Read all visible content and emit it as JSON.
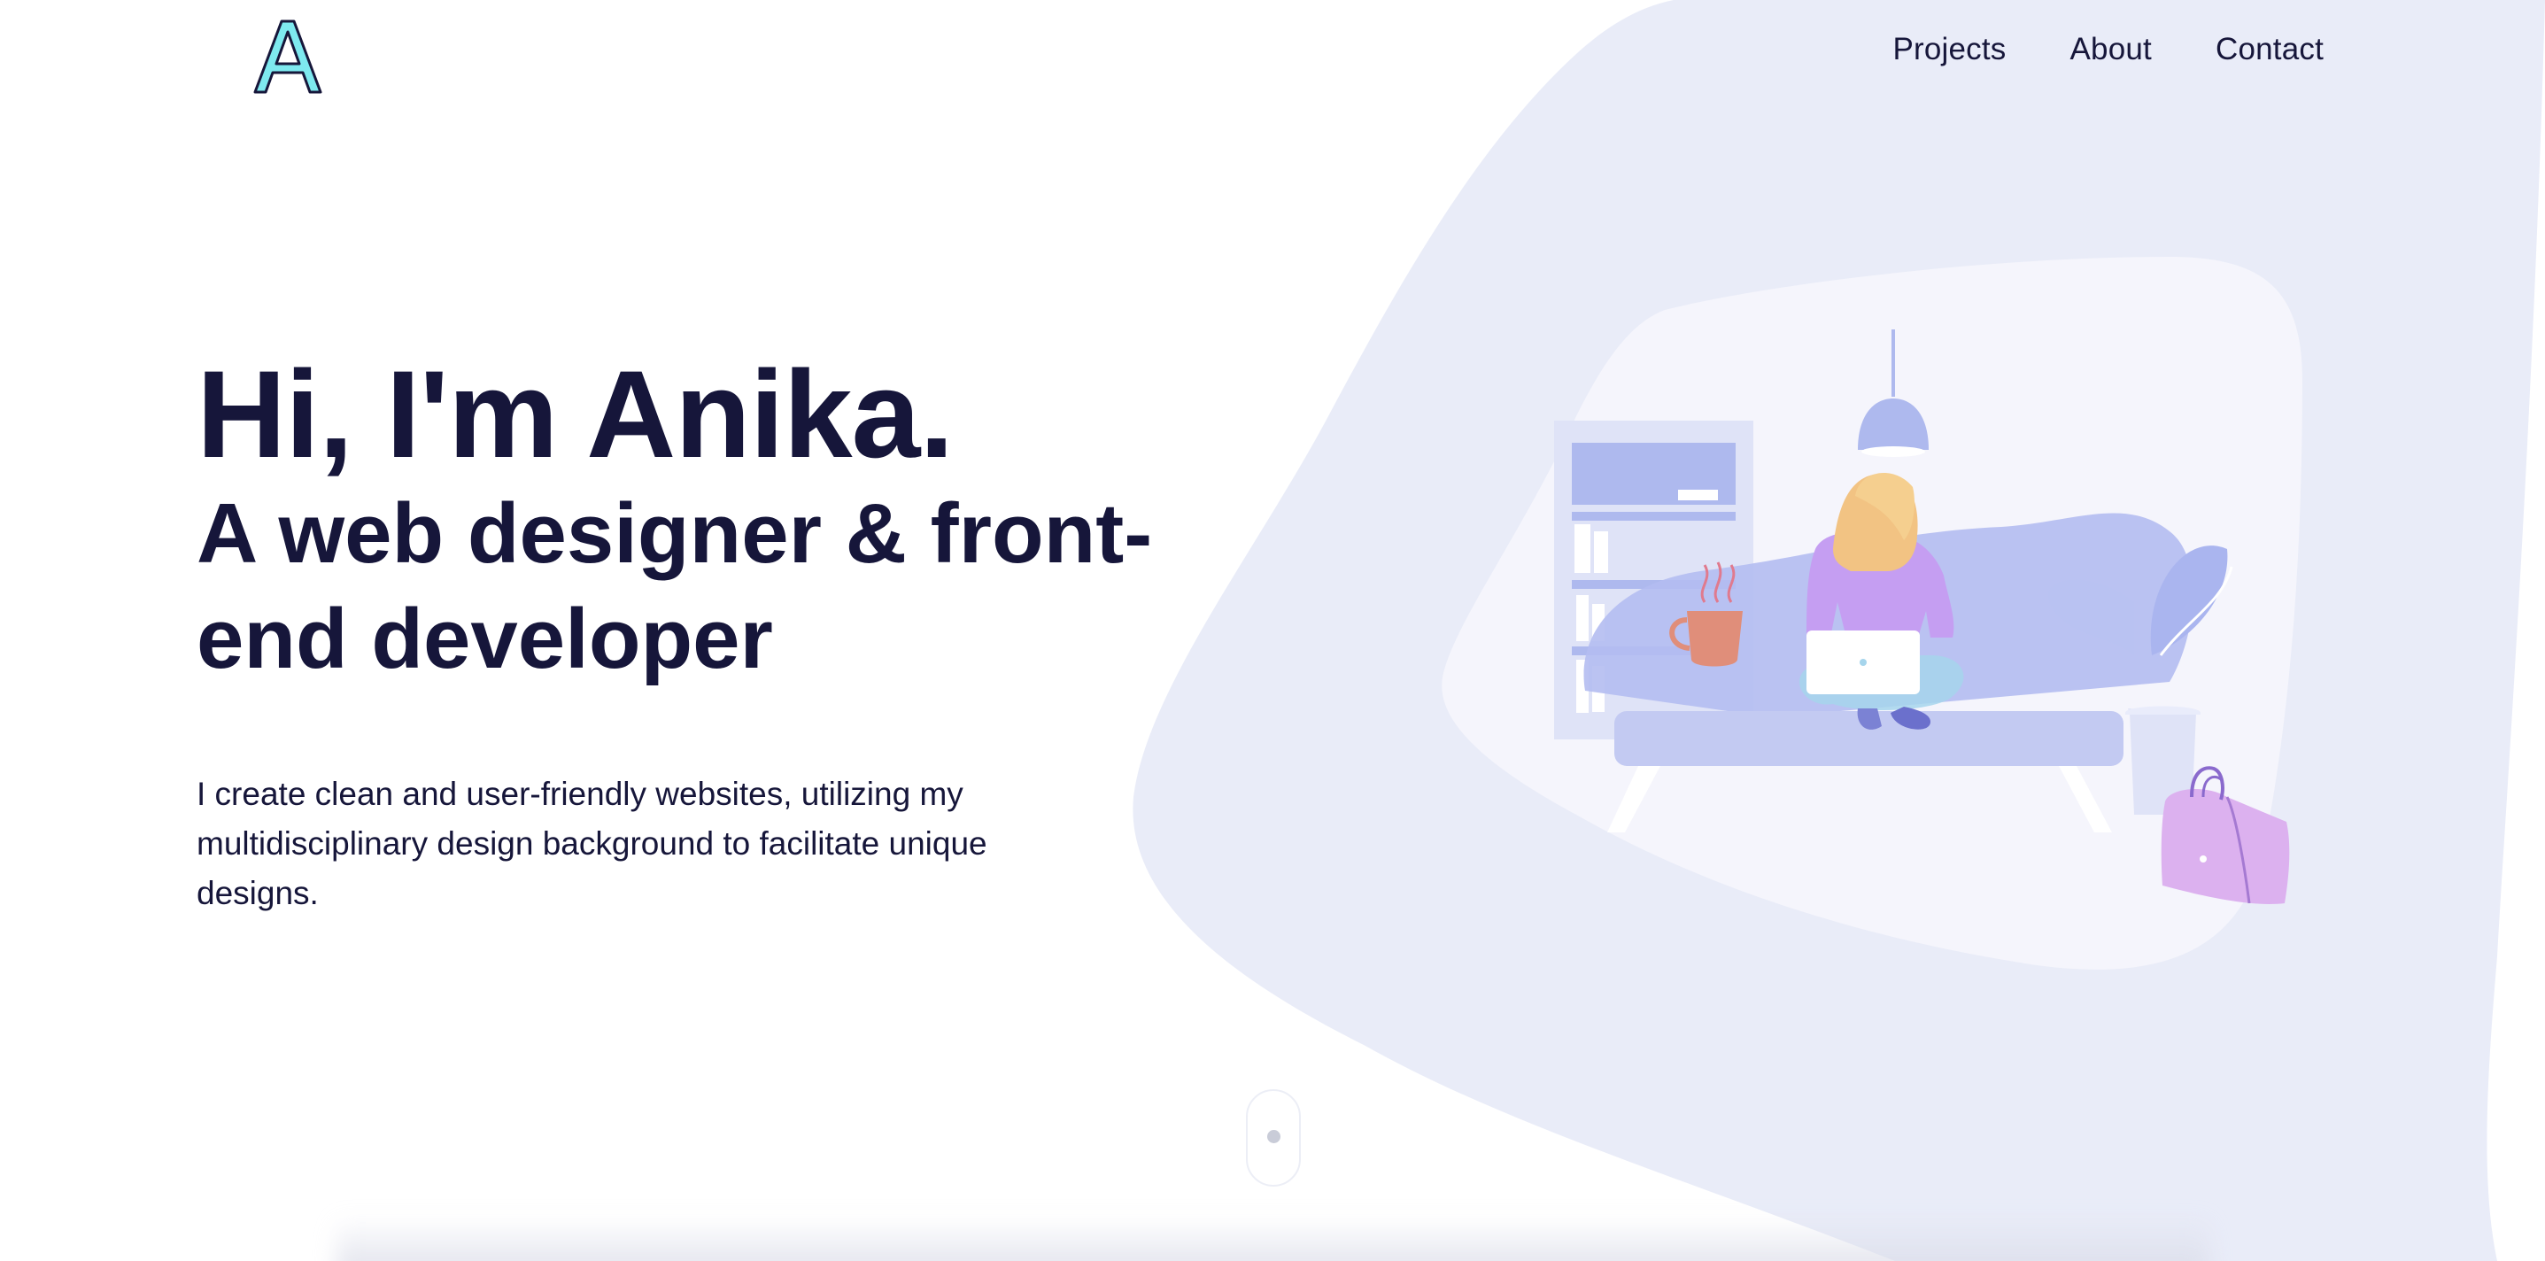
{
  "logo": {
    "letter": "A",
    "icon": "letter-a-logo-icon"
  },
  "nav": {
    "items": [
      {
        "label": "Projects"
      },
      {
        "label": "About"
      },
      {
        "label": "Contact"
      }
    ]
  },
  "hero": {
    "greeting": "Hi, I'm Anika.",
    "tagline": "A web designer & front-end developer",
    "description": "I create clean and user-friendly websites, utilizing my multidisciplinary design background to facilitate unique designs."
  },
  "illustration": {
    "icon": "woman-on-sofa-with-laptop-illustration"
  },
  "scroll": {
    "icon": "mouse-scroll-icon"
  },
  "colors": {
    "text": "#16163a",
    "blob": "#e9ecf8",
    "accent": "#aab5ef",
    "logo": "#5fe0e8"
  }
}
